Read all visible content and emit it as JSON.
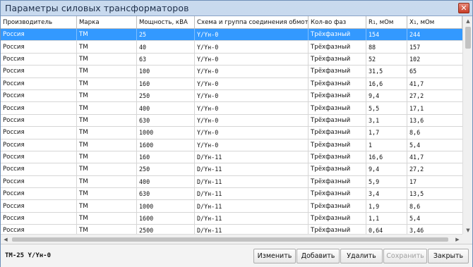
{
  "window": {
    "title": "Параметры силовых трансформаторов",
    "close_glyph": "✕"
  },
  "table": {
    "columns": [
      "Производитель",
      "Марка",
      "Мощность, кВА",
      "Схема и группа соединения обмоток",
      "Кол-во фаз",
      "R",
      "X"
    ],
    "column_subscripts": {
      "R": "1",
      "X": "1"
    },
    "column_units": {
      "R": ", мОм",
      "X": ", мОм"
    },
    "selected_row_index": 0,
    "rows": [
      [
        "Россия",
        "ТМ",
        "25",
        "Y/Yн-0",
        "Трёхфазный",
        "154",
        "244"
      ],
      [
        "Россия",
        "ТМ",
        "40",
        "Y/Yн-0",
        "Трёхфазный",
        "88",
        "157"
      ],
      [
        "Россия",
        "ТМ",
        "63",
        "Y/Yн-0",
        "Трёхфазный",
        "52",
        "102"
      ],
      [
        "Россия",
        "ТМ",
        "100",
        "Y/Yн-0",
        "Трёхфазный",
        "31,5",
        "65"
      ],
      [
        "Россия",
        "ТМ",
        "160",
        "Y/Yн-0",
        "Трёхфазный",
        "16,6",
        "41,7"
      ],
      [
        "Россия",
        "ТМ",
        "250",
        "Y/Yн-0",
        "Трёхфазный",
        "9,4",
        "27,2"
      ],
      [
        "Россия",
        "ТМ",
        "400",
        "Y/Yн-0",
        "Трёхфазный",
        "5,5",
        "17,1"
      ],
      [
        "Россия",
        "ТМ",
        "630",
        "Y/Yн-0",
        "Трёхфазный",
        "3,1",
        "13,6"
      ],
      [
        "Россия",
        "ТМ",
        "1000",
        "Y/Yн-0",
        "Трёхфазный",
        "1,7",
        "8,6"
      ],
      [
        "Россия",
        "ТМ",
        "1600",
        "Y/Yн-0",
        "Трёхфазный",
        "1",
        "5,4"
      ],
      [
        "Россия",
        "ТМ",
        "160",
        "D/Yн-11",
        "Трёхфазный",
        "16,6",
        "41,7"
      ],
      [
        "Россия",
        "ТМ",
        "250",
        "D/Yн-11",
        "Трёхфазный",
        "9,4",
        "27,2"
      ],
      [
        "Россия",
        "ТМ",
        "400",
        "D/Yн-11",
        "Трёхфазный",
        "5,9",
        "17"
      ],
      [
        "Россия",
        "ТМ",
        "630",
        "D/Yн-11",
        "Трёхфазный",
        "3,4",
        "13,5"
      ],
      [
        "Россия",
        "ТМ",
        "1000",
        "D/Yн-11",
        "Трёхфазный",
        "1,9",
        "8,6"
      ],
      [
        "Россия",
        "ТМ",
        "1600",
        "D/Yн-11",
        "Трёхфазный",
        "1,1",
        "5,4"
      ],
      [
        "Россия",
        "ТМ",
        "2500",
        "D/Yн-11",
        "Трёхфазный",
        "0,64",
        "3,46"
      ]
    ]
  },
  "status_text": "ТМ-25 Y/Yн-0",
  "buttons": {
    "edit": "Изменить",
    "add": "Добавить",
    "delete": "Удалить",
    "save": "Сохранить",
    "close": "Закрыть"
  },
  "colors": {
    "selection": "#3399ff",
    "close_button": "#c73b25"
  }
}
